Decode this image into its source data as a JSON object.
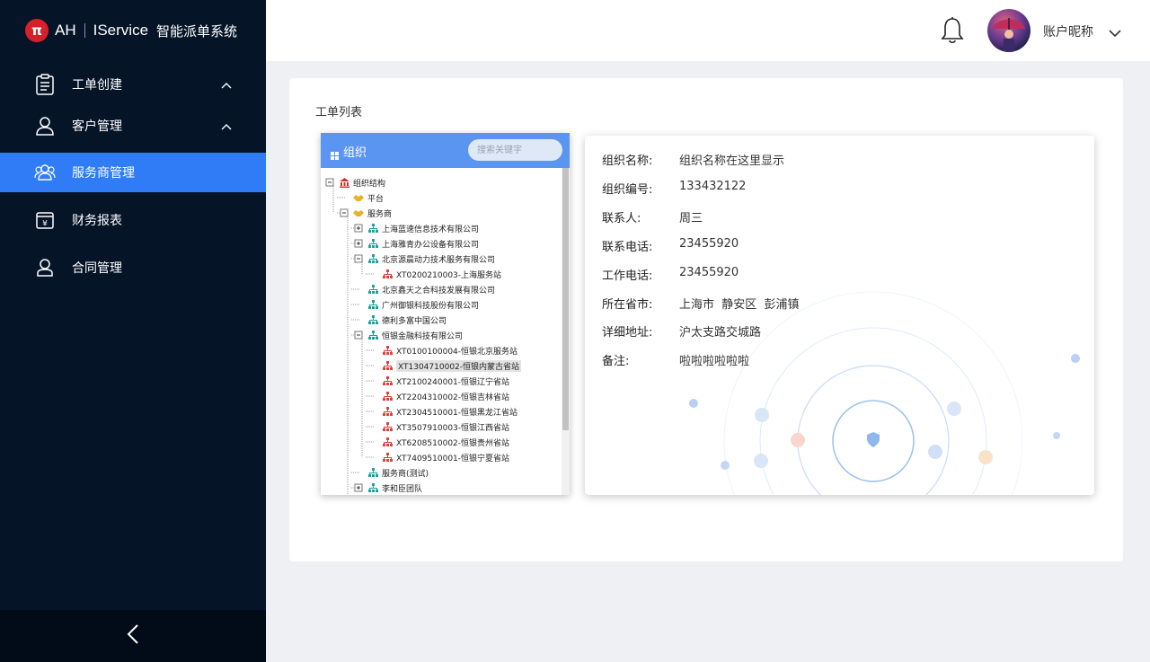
{
  "brand": {
    "mark": "π",
    "ah": "AH",
    "iservice": "IService",
    "product": "智能派单系统"
  },
  "sidebar": {
    "items": [
      {
        "label": "工单创建",
        "icon": "clipboard-icon",
        "expandable": true
      },
      {
        "label": "客户管理",
        "icon": "user-icon",
        "expandable": true
      },
      {
        "label": "服务商管理",
        "icon": "group-icon",
        "active": true
      },
      {
        "label": "财务报表",
        "icon": "yen-icon"
      },
      {
        "label": "合同管理",
        "icon": "contract-user-icon"
      }
    ],
    "collapse_icon": "chevron-left-icon"
  },
  "header": {
    "account_name": "账户昵称"
  },
  "card": {
    "title": "工单列表"
  },
  "tree": {
    "title": "组织",
    "search_placeholder": "搜索关键字",
    "nodes": [
      {
        "label": "组织结构",
        "icon": "bank-icon"
      },
      {
        "label": "平台",
        "icon": "handshake-icon"
      },
      {
        "label": "服务商",
        "icon": "handshake-icon"
      },
      {
        "label": "上海蓝速信息技术有限公司",
        "icon": "org-icon"
      },
      {
        "label": "上海雅青办公设备有限公司",
        "icon": "org-icon"
      },
      {
        "label": "北京源晨动力技术服务有限公司",
        "icon": "org-icon"
      },
      {
        "label": "XT0200210003-上海服务站",
        "icon": "station-icon"
      },
      {
        "label": "北京鑫天之合科技发展有限公司",
        "icon": "org-icon"
      },
      {
        "label": "广州御银科技股份有限公司",
        "icon": "org-icon"
      },
      {
        "label": "德利多富中国公司",
        "icon": "org-icon"
      },
      {
        "label": "恒银金融科技有限公司",
        "icon": "org-icon"
      },
      {
        "label": "XT0100100004-恒银北京服务站",
        "icon": "station-icon"
      },
      {
        "label": "XT1304710002-恒银内蒙古省站",
        "icon": "station-icon",
        "selected": true
      },
      {
        "label": "XT2100240001-恒银辽宁省站",
        "icon": "station-icon"
      },
      {
        "label": "XT2204310002-恒银吉林省站",
        "icon": "station-icon"
      },
      {
        "label": "XT2304510001-恒银黑龙江省站",
        "icon": "station-icon"
      },
      {
        "label": "XT3507910003-恒银江西省站",
        "icon": "station-icon"
      },
      {
        "label": "XT6208510002-恒银贵州省站",
        "icon": "station-icon"
      },
      {
        "label": "XT7409510001-恒银宁夏省站",
        "icon": "station-icon"
      },
      {
        "label": "服务商(测试)",
        "icon": "org-icon"
      },
      {
        "label": "李和臣团队",
        "icon": "org-icon"
      }
    ]
  },
  "detail": {
    "fields": [
      {
        "key": "组织名称:",
        "value": "组织名称在这里显示"
      },
      {
        "key": "组织编号:",
        "value": "133432122"
      },
      {
        "key": "联系人:",
        "value": "周三"
      },
      {
        "key": "联系电话:",
        "value": "23455920"
      },
      {
        "key": "工作电话:",
        "value": "23455920"
      },
      {
        "key": "所在省市:",
        "value": "上海市  静安区  彭浦镇"
      },
      {
        "key": "详细地址:",
        "value": "沪太支路交城路"
      },
      {
        "key": "备注:",
        "value": "啦啦啦啦啦啦"
      }
    ]
  },
  "colors": {
    "sidebar_bg": "#061428",
    "active": "#2f7cf6",
    "tree_header": "#5b95f2",
    "brand_red": "#d8202a"
  }
}
